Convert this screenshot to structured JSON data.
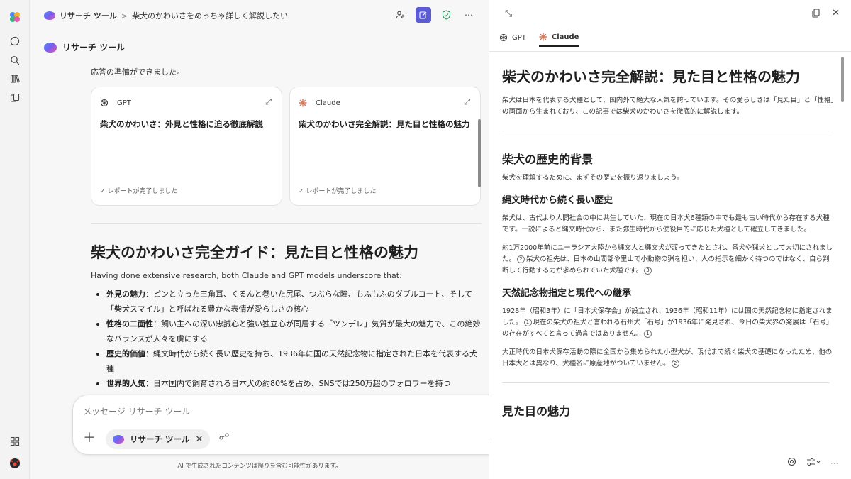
{
  "topbar": {
    "app_name": "リサーチ ツール",
    "separator": ">",
    "conversation_title": "柴犬のかわいさをめっちゃ詳しく解説したい"
  },
  "agent": {
    "name": "リサーチ ツール",
    "status": "応答の準備ができました。"
  },
  "cards": [
    {
      "model": "GPT",
      "title": "柴犬のかわいさ：外見と性格に迫る徹底解説",
      "status": "✓ レポートが完了しました"
    },
    {
      "model": "Claude",
      "title": "柴犬のかわいさ完全解説：見た目と性格の魅力",
      "status": "✓ レポートが完了しました"
    }
  ],
  "summary": {
    "heading": "柴犬のかわいさ完全ガイド：見た目と性格の魅力",
    "lead": "Having done extensive research, both Claude and GPT models underscore that:",
    "bullets": [
      {
        "label": "外見の魅力",
        "text": "：ピンと立った三角耳、くるんと巻いた尻尾、つぶらな瞳、もふもふのダブルコート、そして「柴犬スマイル」と呼ばれる豊かな表情が愛らしさの核心"
      },
      {
        "label": "性格の二面性",
        "text": "：飼い主への深い忠誠心と強い独立心が同居する「ツンデレ」気質が最大の魅力で、この絶妙なバランスが人々を虜にする"
      },
      {
        "label": "歴史的価値",
        "text": "：縄文時代から続く長い歴史を持ち、1936年に国の天然記念物に指定された日本を代表する犬種"
      },
      {
        "label": "世界的人気",
        "text": "：日本国内で飼育される日本犬の約80%を占め、SNSでは250万超のフォロワーを持つ"
      }
    ]
  },
  "composer": {
    "placeholder": "メッセージ リサーチ ツール",
    "tool_pill": "リサーチ ツール",
    "remove": "✕"
  },
  "disclaimer": "AI で生成されたコンテンツは誤りを含む可能性があります。",
  "panel": {
    "tabs": [
      {
        "label": "GPT"
      },
      {
        "label": "Claude"
      }
    ],
    "doc": {
      "title": "柴犬のかわいさ完全解説：見た目と性格の魅力",
      "intro": "柴犬は日本を代表する犬種として、国内外で絶大な人気を誇っています。その愛らしさは「見た目」と「性格」の両面から生まれており、この記事では柴犬のかわいさを徹底的に解説します。",
      "s1_heading": "柴犬の歴史的背景",
      "s1_text": "柴犬を理解するために、まずその歴史を振り返りましょう。",
      "s1a_heading": "縄文時代から続く長い歴史",
      "s1a_p1": "柴犬は、古代より人間社会の中に共生していた、現在の日本犬6種類の中でも最も古い時代から存在する犬種です。一説によると縄文時代から、また弥生時代から使役目的に応じた犬種として確立してきました。",
      "s1a_p2a": "約1万2000年前にユーラシア大陸から縄文人と縄文犬が渡ってきたとされ、番犬や猟犬として大切にされました。",
      "s1a_p2b": "柴犬の祖先は、日本の山間部や里山で小動物の猟を担い、人の指示を細かく待つのではなく、自ら判断して行動する力が求められていた犬種です。",
      "s1b_heading": "天然記念物指定と現代への継承",
      "s1b_p1a": "1928年（昭和3年）に「日本犬保存会」が設立され、1936年（昭和11年）には国の天然記念物に指定されました。",
      "s1b_p1b": "現在の柴犬の祖犬と言われる石州犬「石号」が1936年に発見され、今日の柴犬界の発展は「石号」の存在がすべてと言って過言ではありません。",
      "s1b_p2": "大正時代の日本犬保存活動の際に全国から集められた小型犬が、現代まで続く柴犬の基礎になったため、他の日本犬とは異なり、犬種名に原産地がついていません。",
      "s2_heading": "見た目の魅力",
      "cites": {
        "c1": "1",
        "c2": "2",
        "c3": "3"
      }
    }
  }
}
